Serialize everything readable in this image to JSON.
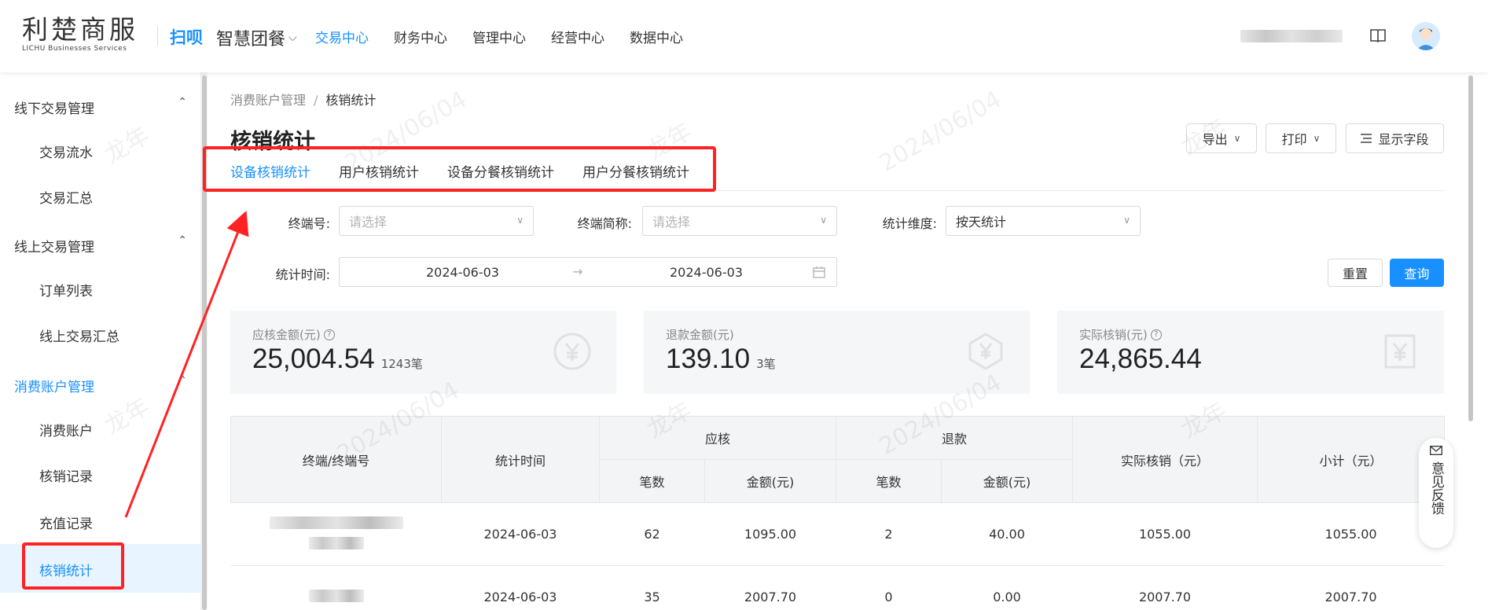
{
  "header": {
    "logo_main": "利楚商服",
    "logo_sub": "LICHU Businesses Services",
    "scan_label": "扫呗",
    "app_name": "智慧团餐",
    "nav": [
      "交易中心",
      "财务中心",
      "管理中心",
      "经营中心",
      "数据中心"
    ],
    "active_nav": "交易中心"
  },
  "sidebar": {
    "groups": [
      {
        "label": "线下交易管理",
        "items": [
          "交易流水",
          "交易汇总"
        ]
      },
      {
        "label": "线上交易管理",
        "items": [
          "订单列表",
          "线上交易汇总"
        ]
      },
      {
        "label": "消费账户管理",
        "items": [
          "消费账户",
          "核销记录",
          "充值记录",
          "核销统计"
        ]
      }
    ],
    "active_group": "消费账户管理",
    "active_item": "核销统计"
  },
  "breadcrumb": {
    "parent": "消费账户管理",
    "separator": "/",
    "current": "核销统计"
  },
  "page_title": "核销统计",
  "toolbar": {
    "export_label": "导出",
    "print_label": "打印",
    "fields_label": "显示字段"
  },
  "tabs": [
    "设备核销统计",
    "用户核销统计",
    "设备分餐核销统计",
    "用户分餐核销统计"
  ],
  "active_tab": "设备核销统计",
  "filters": {
    "terminal_label": "终端号:",
    "terminal_placeholder": "请选择",
    "terminal_name_label": "终端简称:",
    "terminal_name_placeholder": "请选择",
    "dimension_label": "统计维度:",
    "dimension_value": "按天统计",
    "time_label": "统计时间:",
    "date_start": "2024-06-03",
    "date_end": "2024-06-03",
    "reset_label": "重置",
    "query_label": "查询"
  },
  "cards": [
    {
      "label": "应核金额(元)",
      "value": "25,004.54",
      "count": "1243笔",
      "help": true,
      "icon": "yen-circle-icon"
    },
    {
      "label": "退款金额(元)",
      "value": "139.10",
      "count": "3笔",
      "help": false,
      "icon": "refund-icon"
    },
    {
      "label": "实际核销(元)",
      "value": "24,865.44",
      "count": "",
      "help": true,
      "icon": "receipt-icon"
    }
  ],
  "table": {
    "headers": {
      "terminal": "终端/终端号",
      "time": "统计时间",
      "due_group": "应核",
      "refund_group": "退款",
      "actual": "实际核销（元）",
      "subtotal": "小计（元）",
      "count": "笔数",
      "amount": "金额(元)"
    },
    "rows": [
      {
        "time": "2024-06-03",
        "due_count": "62",
        "due_amount": "1095.00",
        "refund_count": "2",
        "refund_amount": "40.00",
        "actual": "1055.00",
        "subtotal": "1055.00"
      },
      {
        "time": "2024-06-03",
        "due_count": "35",
        "due_amount": "2007.70",
        "refund_count": "0",
        "refund_amount": "0.00",
        "actual": "2007.70",
        "subtotal": "2007.70"
      }
    ]
  },
  "feedback_label": "意见反馈",
  "watermark_text": [
    "龙年",
    "2024/06/04"
  ]
}
